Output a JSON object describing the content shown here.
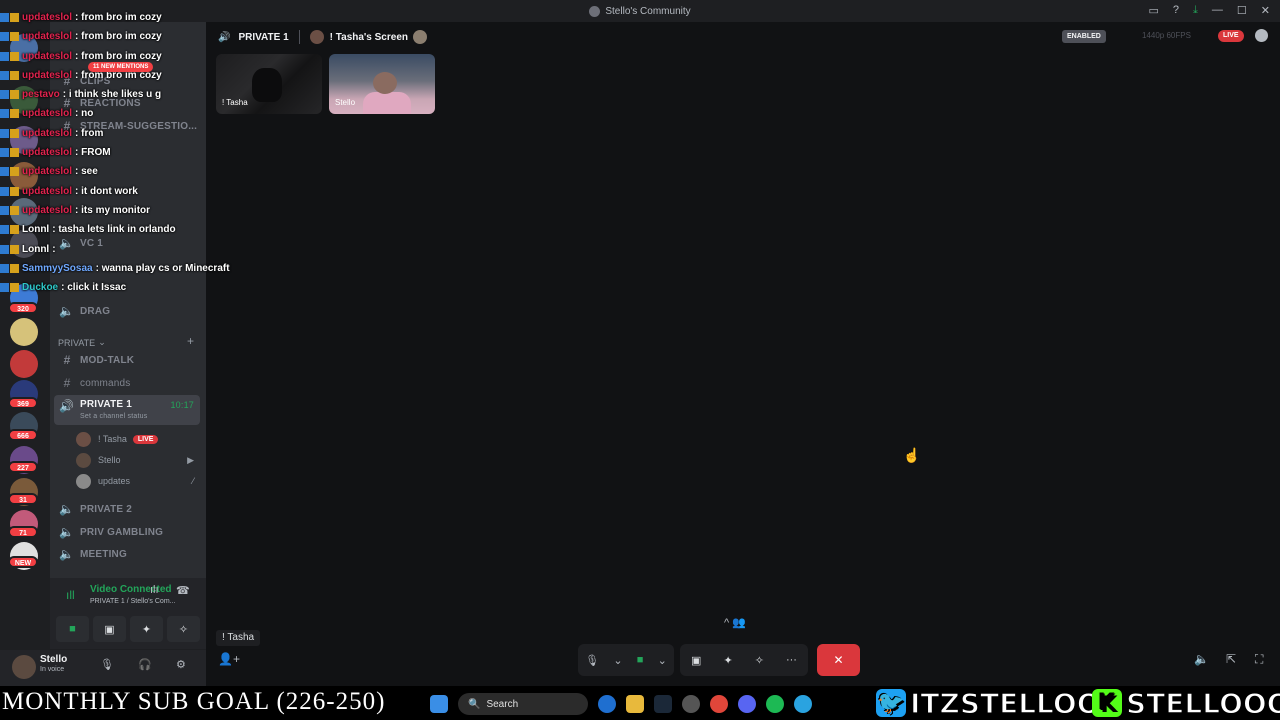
{
  "window": {
    "title": "Stello's Community"
  },
  "server": {
    "channels": [
      {
        "name": "CLIPS",
        "icon": "#"
      },
      {
        "name": "REACTIONS",
        "icon": "#"
      },
      {
        "name": "STREAM-SUGGESTIO...",
        "icon": "#"
      },
      {
        "name": "VC 1",
        "icon": "speaker"
      },
      {
        "name": "DRAG",
        "icon": "speaker"
      },
      {
        "name": "MOD-TALK",
        "icon": "#"
      },
      {
        "name": "commands",
        "icon": "#"
      },
      {
        "name": "PRIVATE 2",
        "icon": "speaker"
      },
      {
        "name": "PRIV GAMBLING",
        "icon": "speaker"
      },
      {
        "name": "MEETING",
        "icon": "speaker"
      }
    ],
    "category_private": "PRIVATE",
    "active_channel": {
      "name": "PRIVATE 1",
      "time": "10:17",
      "status": "Set a channel status"
    },
    "voice_users": [
      {
        "name": "! Tasha",
        "live": "LIVE"
      },
      {
        "name": "Stello"
      },
      {
        "name": "updates"
      }
    ],
    "new_mentions": "11 NEW MENTIONS",
    "guild_badges": [
      "27",
      "320",
      "369",
      "666",
      "227",
      "31",
      "71",
      "NEW"
    ]
  },
  "voice_panel": {
    "title": "Video Connected",
    "subtitle": "PRIVATE 1 / Stello's Com..."
  },
  "user_panel": {
    "name": "Stello",
    "status": "In voice"
  },
  "stage": {
    "channel": "PRIVATE 1",
    "screen_label": "! Tasha's Screen",
    "enabled": "ENABLED",
    "quality": "1440p 60FPS",
    "live": "LIVE",
    "tiles": [
      {
        "name": "! Tasha"
      },
      {
        "name": "Stello"
      }
    ],
    "chat_tag": "! Tasha"
  },
  "overlay_chat": [
    {
      "user": "updateslol",
      "text": ": from bro im cozy",
      "color": "#e0234e"
    },
    {
      "user": "updateslol",
      "text": ": from bro im cozy",
      "color": "#e0234e"
    },
    {
      "user": "updateslol",
      "text": ": from bro im cozy",
      "color": "#e0234e"
    },
    {
      "user": "updateslol",
      "text": ": from bro im cozy",
      "color": "#e0234e"
    },
    {
      "user": "pestavo",
      "text": ": i think she likes u g",
      "color": "#e0234e"
    },
    {
      "user": "updateslol",
      "text": ": no",
      "color": "#e0234e"
    },
    {
      "user": "updateslol",
      "text": ": from",
      "color": "#e0234e"
    },
    {
      "user": "updateslol",
      "text": ": FROM",
      "color": "#e0234e"
    },
    {
      "user": "updateslol",
      "text": ": see",
      "color": "#e0234e"
    },
    {
      "user": "updateslol",
      "text": ": it dont work",
      "color": "#e0234e"
    },
    {
      "user": "updateslol",
      "text": ": its my monitor",
      "color": "#e0234e"
    },
    {
      "user": "Lonnl",
      "text": ": tasha lets link in orlando",
      "color": "#ffffff"
    },
    {
      "user": "Lonnl",
      "text": ":",
      "color": "#ffffff"
    },
    {
      "user": "SammyySosaa",
      "text": ": wanna play cs or Minecraft",
      "color": "#6fa8ff"
    },
    {
      "user": "Duckoe",
      "text": ": click it Issac",
      "color": "#2ec7c7"
    }
  ],
  "bottom": {
    "goal": "MONTHLY SUB GOAL (226-250)",
    "search": "Search",
    "twitter": "ITZSTELLOO",
    "kick": "STELLOOO"
  },
  "colors": {
    "accent_green": "#23a55a",
    "live_red": "#da373c",
    "sidebar": "#2b2d31",
    "stage": "#111214"
  }
}
